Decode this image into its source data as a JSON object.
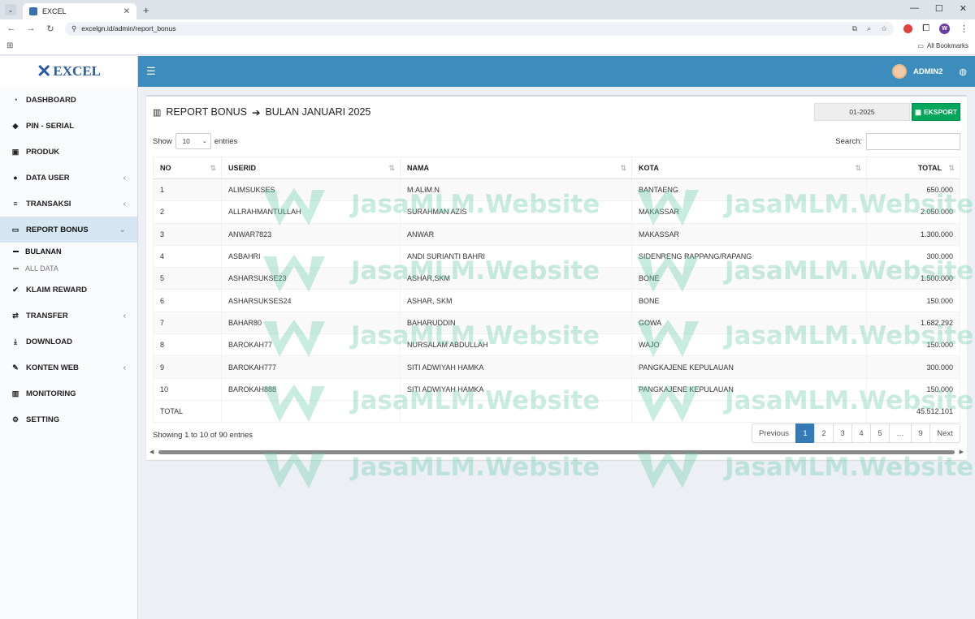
{
  "browser": {
    "tab_title": "EXCEL",
    "url": "excelgn.id/admin/report_bonus",
    "bookmarks_label": "All Bookmarks",
    "ext_avatar": "W"
  },
  "sidebar": {
    "logo": "EXCEL",
    "items": [
      {
        "label": "DASHBOARD",
        "icon": "dashboard-icon",
        "glyph": "◔"
      },
      {
        "label": "PIN - SERIAL",
        "icon": "tag-icon",
        "glyph": "◆"
      },
      {
        "label": "PRODUK",
        "icon": "cube-icon",
        "glyph": "▣"
      },
      {
        "label": "DATA USER",
        "icon": "users-icon",
        "glyph": "●"
      },
      {
        "label": "TRANSAKSI",
        "icon": "list-icon",
        "glyph": "≡"
      },
      {
        "label": "REPORT BONUS",
        "icon": "money-icon",
        "glyph": "▭"
      },
      {
        "label": "KLAIM REWARD",
        "icon": "check-icon",
        "glyph": "✔"
      },
      {
        "label": "TRANSFER",
        "icon": "exchange-icon",
        "glyph": "⇄"
      },
      {
        "label": "DOWNLOAD",
        "icon": "download-icon",
        "glyph": "⤓"
      },
      {
        "label": "KONTEN WEB",
        "icon": "edit-icon",
        "glyph": "✎"
      },
      {
        "label": "MONITORING",
        "icon": "bar-chart-icon",
        "glyph": "▥"
      },
      {
        "label": "SETTING",
        "icon": "cogs-icon",
        "glyph": "⚙"
      }
    ],
    "sub_items": [
      "BULANAN",
      "ALL DATA"
    ]
  },
  "topbar": {
    "username": "ADMIN2"
  },
  "report": {
    "title": "REPORT BONUS",
    "subtitle": "BULAN JANUARI 2025",
    "period": "01-2025",
    "export_label": "EKSPORT",
    "show_label": "Show",
    "entries_label": "entries",
    "page_length": "10",
    "search_label": "Search:",
    "columns": [
      "NO",
      "USERID",
      "NAMA",
      "KOTA",
      "TOTAL"
    ],
    "rows": [
      {
        "no": "1",
        "userid": "ALIMSUKSES",
        "nama": "M.ALIM.N",
        "kota": "BANTAENG",
        "total": "650.000"
      },
      {
        "no": "2",
        "userid": "ALLRAHMANTULLAH",
        "nama": "SURAHMAN AZIS",
        "kota": "MAKASSAR",
        "total": "2.050.000"
      },
      {
        "no": "3",
        "userid": "ANWAR7823",
        "nama": "ANWAR",
        "kota": "MAKASSAR",
        "total": "1.300.000"
      },
      {
        "no": "4",
        "userid": "ASBAHRI",
        "nama": "ANDI SURIANTI BAHRI",
        "kota": "SIDENRENG RAPPANG/RAPANG",
        "total": "300.000"
      },
      {
        "no": "5",
        "userid": "ASHARSUKSE23",
        "nama": "ASHAR,SKM",
        "kota": "BONE",
        "total": "1.500.000"
      },
      {
        "no": "6",
        "userid": "ASHARSUKSES24",
        "nama": "ASHAR, SKM",
        "kota": "BONE",
        "total": "150.000"
      },
      {
        "no": "7",
        "userid": "BAHAR80",
        "nama": "BAHARUDDIN",
        "kota": "GOWA",
        "total": "1.682.292"
      },
      {
        "no": "8",
        "userid": "BAROKAH77",
        "nama": "NURSALAM ABDULLAH",
        "kota": "WAJO",
        "total": "150.000"
      },
      {
        "no": "9",
        "userid": "BAROKAH777",
        "nama": "SITI ADWIYAH HAMKA",
        "kota": "PANGKAJENE KEPULAUAN",
        "total": "300.000"
      },
      {
        "no": "10",
        "userid": "BAROKAH888",
        "nama": "SITI ADWIYAH HAMKA",
        "kota": "PANGKAJENE KEPULAUAN",
        "total": "150.000"
      }
    ],
    "footer_label": "TOTAL",
    "footer_total": "45.512.101",
    "info": "Showing 1 to 10 of 90 entries",
    "pagination": [
      "Previous",
      "1",
      "2",
      "3",
      "4",
      "5",
      "…",
      "9",
      "Next"
    ],
    "current_page": "1"
  },
  "watermark": "JasaMLM.Website",
  "colors": {
    "topbar": "#3c8dbc",
    "export": "#00a65a",
    "active_page": "#337ab7",
    "sidebar_active": "#d4e6f1"
  }
}
